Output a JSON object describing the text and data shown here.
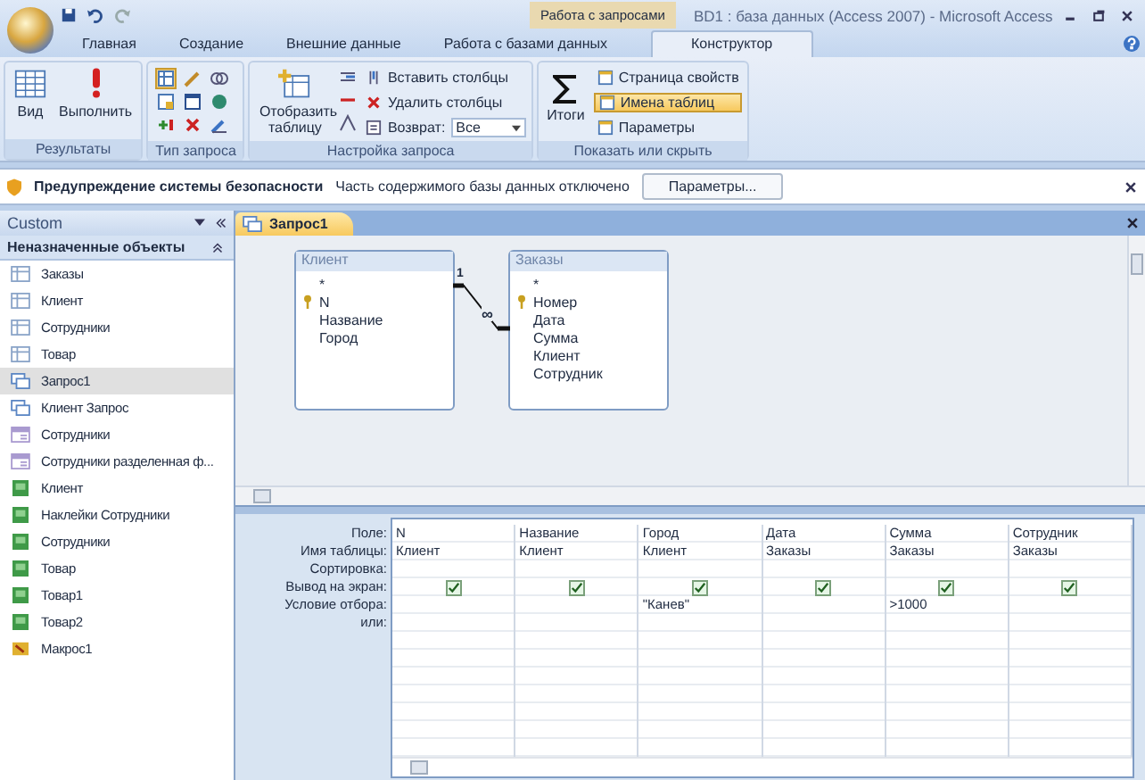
{
  "window": {
    "title": "BD1 : база данных (Access 2007) - Microsoft Access",
    "context_tab": "Работа с запросами"
  },
  "ribbon_tabs": [
    {
      "label": "Главная",
      "selected": false
    },
    {
      "label": "Создание",
      "selected": false
    },
    {
      "label": "Внешние данные",
      "selected": false
    },
    {
      "label": "Работа с базами данных",
      "selected": false
    },
    {
      "label": "Конструктор",
      "selected": true
    }
  ],
  "ribbon_groups": [
    {
      "title": "Результаты",
      "kind": "results",
      "buttons": [
        "Вид",
        "Выполнить"
      ]
    },
    {
      "title": "Тип запроса",
      "kind": "types"
    },
    {
      "title": "Настройка запроса",
      "kind": "setup",
      "buttons": [
        "Отобразить таблицу",
        "Вставить столбцы",
        "Удалить столбцы"
      ],
      "return_label": "Возврат:",
      "return_value": "Все"
    },
    {
      "title": "Показать или скрыть",
      "kind": "show",
      "buttons": [
        "Итоги"
      ],
      "toggles": [
        {
          "label": "Страница свойств",
          "on": false
        },
        {
          "label": "Имена таблиц",
          "on": true
        },
        {
          "label": "Параметры",
          "on": false
        }
      ]
    }
  ],
  "security_bar": {
    "title": "Предупреждение системы безопасности",
    "message": "Часть содержимого базы данных отключено",
    "button": "Параметры..."
  },
  "nav_pane": {
    "title": "Custom",
    "group": "Неназначенные объекты",
    "items": [
      {
        "label": "Заказы",
        "kind": "table",
        "selected": false
      },
      {
        "label": "Клиент",
        "kind": "table",
        "selected": false
      },
      {
        "label": "Сотрудники",
        "kind": "table",
        "selected": false
      },
      {
        "label": "Товар",
        "kind": "table",
        "selected": false
      },
      {
        "label": "Запрос1",
        "kind": "query",
        "selected": true
      },
      {
        "label": "Клиент Запрос",
        "kind": "query",
        "selected": false
      },
      {
        "label": "Сотрудники",
        "kind": "form",
        "selected": false
      },
      {
        "label": "Сотрудники разделенная ф...",
        "kind": "form",
        "selected": false
      },
      {
        "label": "Клиент",
        "kind": "report",
        "selected": false
      },
      {
        "label": "Наклейки Сотрудники",
        "kind": "report",
        "selected": false
      },
      {
        "label": "Сотрудники",
        "kind": "report",
        "selected": false
      },
      {
        "label": "Товар",
        "kind": "report",
        "selected": false
      },
      {
        "label": "Товар1",
        "kind": "report",
        "selected": false
      },
      {
        "label": "Товар2",
        "kind": "report",
        "selected": false
      },
      {
        "label": "Макрос1",
        "kind": "macro",
        "selected": false
      }
    ]
  },
  "document_tab": {
    "label": "Запрос1"
  },
  "tables": [
    {
      "title": "Клиент",
      "fields": [
        {
          "name": "*",
          "key": false
        },
        {
          "name": "N",
          "key": true
        },
        {
          "name": "Название",
          "key": false
        },
        {
          "name": "Город",
          "key": false
        }
      ]
    },
    {
      "title": "Заказы",
      "fields": [
        {
          "name": "*",
          "key": false
        },
        {
          "name": "Номер",
          "key": true
        },
        {
          "name": "Дата",
          "key": false
        },
        {
          "name": "Сумма",
          "key": false
        },
        {
          "name": "Клиент",
          "key": false
        },
        {
          "name": "Сотрудник",
          "key": false
        }
      ]
    }
  ],
  "relationship": {
    "one_label": "1",
    "many_label": "∞"
  },
  "grid": {
    "row_labels": [
      "Поле:",
      "Имя таблицы:",
      "Сортировка:",
      "Вывод на экран:",
      "Условие отбора:",
      "или:"
    ],
    "columns": [
      {
        "field": "N",
        "table": "Клиент",
        "show": true
      },
      {
        "field": "Название",
        "table": "Клиент",
        "show": true
      },
      {
        "field": "Город",
        "table": "Клиент",
        "show": true,
        "criteria": "\"Канев\""
      },
      {
        "field": "Дата",
        "table": "Заказы",
        "show": true
      },
      {
        "field": "Сумма",
        "table": "Заказы",
        "show": true,
        "criteria": ">1000"
      },
      {
        "field": "Сотрудник",
        "table": "Заказы",
        "show": true
      }
    ]
  }
}
